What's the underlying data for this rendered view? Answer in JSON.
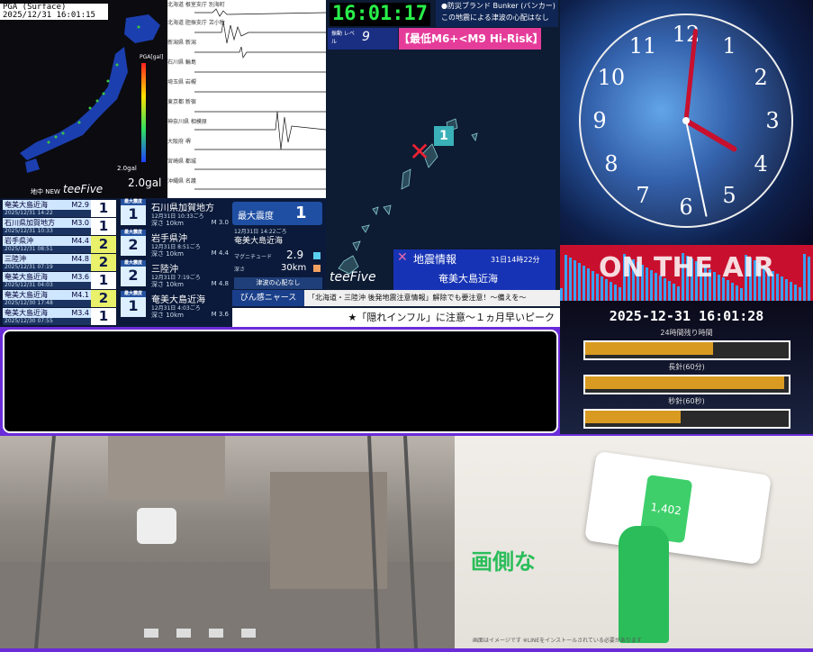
{
  "pga": {
    "label": "PGA (Surface)",
    "datetime": "2025/12/31 16:01:15",
    "scale_value": "2.0gal",
    "scale_unit": "2.0gal",
    "brand": "teeFive",
    "map_caption": "地中 NEW",
    "pga_axis": "PGA[gal]"
  },
  "waves": {
    "rows": [
      "北海道 根室支庁 別海町",
      "北海道 胆振支庁 苫小牧",
      "新潟県 新潟",
      "石川県 輪島",
      "埼玉県 岩槻",
      "東京都 新宿",
      "神奈川県 相模原",
      "大阪府 堺",
      "宮崎県 都城",
      "沖縄県 名護"
    ]
  },
  "stations": [
    {
      "name": "奄美大島近海",
      "date": "2025/12/31 14:22",
      "mag": "M2.9",
      "shindo": "1"
    },
    {
      "name": "石川県加賀地方",
      "date": "2025/12/31 10:33",
      "mag": "M3.0",
      "shindo": "1"
    },
    {
      "name": "岩手県沖",
      "date": "2025/12/31 08:51",
      "mag": "M4.4",
      "shindo": "2"
    },
    {
      "name": "三陸沖",
      "date": "2025/12/31 07:19",
      "mag": "M4.8",
      "shindo": "2"
    },
    {
      "name": "奄美大島近海",
      "date": "2025/12/31 04:03",
      "mag": "M3.6",
      "shindo": "1"
    },
    {
      "name": "奄美大島近海",
      "date": "2025/12/30 17:48",
      "mag": "M4.1",
      "shindo": "2"
    },
    {
      "name": "奄美大島近海",
      "date": "2025/12/30 07:55",
      "mag": "M3.4",
      "shindo": "1"
    }
  ],
  "detail": [
    {
      "area": "石川県加賀地方",
      "date": "12月31日 10:33ごろ",
      "depth": "深さ 10km",
      "mag": "M 3.0",
      "shindo": "1",
      "tag": "最大震度"
    },
    {
      "area": "岩手県沖",
      "date": "12月31日 8:51ごろ",
      "depth": "深さ 10km",
      "mag": "M 4.4",
      "shindo": "2",
      "tag": "最大震度"
    },
    {
      "area": "三陸沖",
      "date": "12月31日 7:19ごろ",
      "depth": "深さ 10km",
      "mag": "M 4.8",
      "shindo": "2",
      "tag": "最大震度"
    },
    {
      "area": "奄美大島近海",
      "date": "12月31日 4:03ごろ",
      "depth": "深さ 10km",
      "mag": "M 3.6",
      "shindo": "1",
      "tag": "最大震度"
    }
  ],
  "max_intensity": {
    "label": "最大震度",
    "value": "1",
    "date": "12月31日 14:22ごろ",
    "area": "奄美大島近海",
    "mag_label": "マグニチュード",
    "mag": "2.9",
    "depth_label": "深さ",
    "depth": "30km",
    "tsunami": "津波の心配なし"
  },
  "center": {
    "clock": "16:01:17",
    "bunker": "●防災ブランド Bunker (バンカー)",
    "bunker_msg": "この地震による津波の心配はなし",
    "level_label": "振動\nレベル",
    "level": "9",
    "risk": "【最低M6+<M9 Hi-Risk】",
    "marker": "1",
    "brand": "teeFive"
  },
  "eq_info": {
    "title": "地震情報",
    "time": "31日14時22分",
    "area": "奄美大島近海"
  },
  "ticker1": {
    "source": "びん感ニャース",
    "text": "「北海道・三陸沖 後発地震注意情報」解除でも要注意！〜備えを〜"
  },
  "ticker2": {
    "text": "★「隠れインフル」に注意〜１ヵ月早いピーク"
  },
  "clock": {
    "numbers": [
      "12",
      "1",
      "2",
      "3",
      "4",
      "5",
      "6",
      "7",
      "8",
      "9",
      "10",
      "11"
    ],
    "hour": 4,
    "minute": 1,
    "second": 28
  },
  "onair": {
    "text": "ON THE AIR"
  },
  "timer": {
    "datetime": "2025-12-31 16:01:28",
    "bars": [
      {
        "label": "24時間残り時間",
        "fill": 0.63
      },
      {
        "label": "長針(60分)",
        "fill": 0.98
      },
      {
        "label": "秒針(60秒)",
        "fill": 0.47
      }
    ]
  },
  "cam2": {
    "caption": "画面はイメージです ※LINEをインストールされている必要があります",
    "overlay": "画側な",
    "phone_value": "1,402"
  }
}
